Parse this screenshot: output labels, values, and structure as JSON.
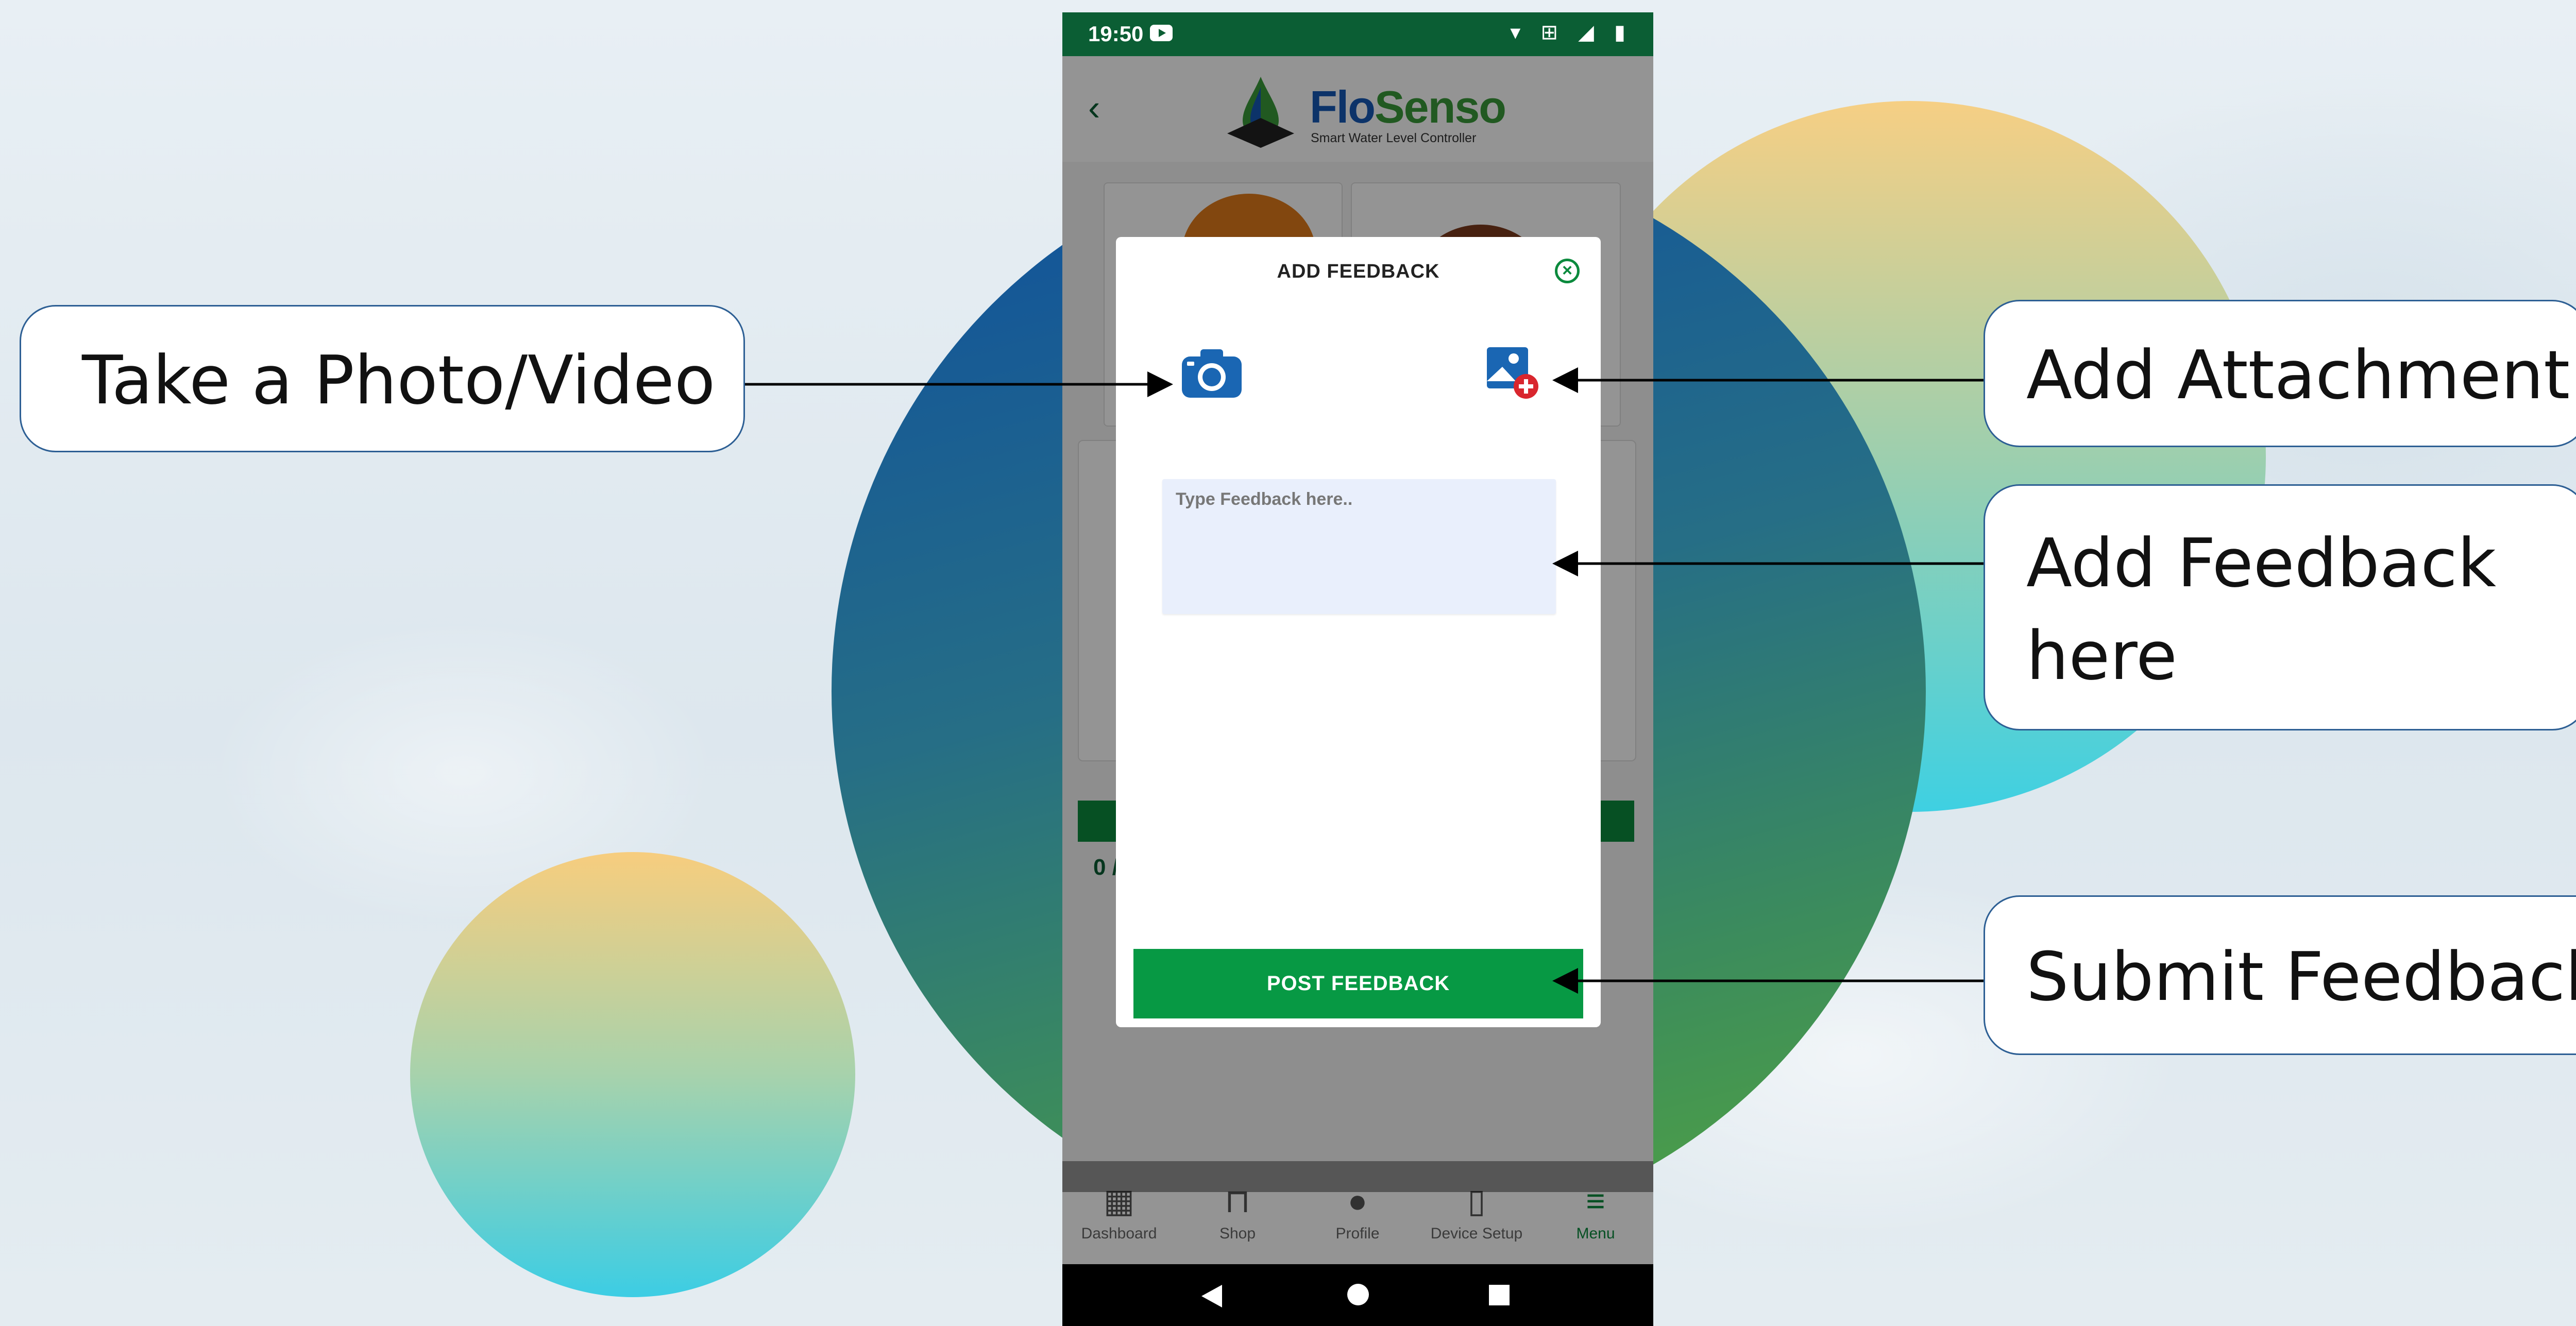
{
  "status_bar": {
    "time": "19:50",
    "icons": "▾ ⊞ ◢ ▮"
  },
  "app": {
    "brand_part1": "Flo",
    "brand_part2": "Senso",
    "tagline": "Smart Water Level Controller"
  },
  "background_content": {
    "count_text": "0 /"
  },
  "dialog": {
    "title": "ADD FEEDBACK",
    "close_symbol": "×",
    "feedback_placeholder": "Type Feedback here..",
    "feedback_value": "",
    "post_label": "POST FEEDBACK"
  },
  "bottom_nav": {
    "items": [
      {
        "label": "Dashboard",
        "icon": "dashboard-icon",
        "active": false
      },
      {
        "label": "Shop",
        "icon": "shopping-bag-icon",
        "active": false
      },
      {
        "label": "Profile",
        "icon": "person-icon",
        "active": false
      },
      {
        "label": "Device Setup",
        "icon": "device-setup-icon",
        "active": false
      },
      {
        "label": "Menu",
        "icon": "menu-icon",
        "active": true
      }
    ]
  },
  "callouts": {
    "photo": "Take a Photo/Video",
    "attachment": "Add Attachment",
    "feedback": "Add Feedback here",
    "submit": "Submit Feedback"
  },
  "colors": {
    "brand_green": "#079944",
    "status_bar": "#0b5e34",
    "brand_blue": "#1559b6",
    "input_bg": "#e9effc",
    "callout_border": "#2d5f94"
  }
}
